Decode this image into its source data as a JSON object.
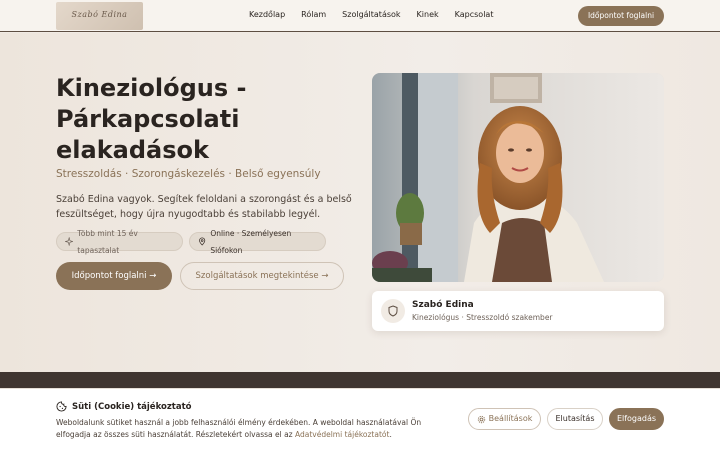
{
  "header": {
    "logo_text": "Szabó Edina",
    "nav": [
      "Kezdőlap",
      "Rólam",
      "Szolgáltatások",
      "Kinek",
      "Kapcsolat"
    ],
    "cta_label": "Időpontot foglalni"
  },
  "hero": {
    "title": "Kineziológus - Párkapcsolati elakadások",
    "subtitle": "Stresszoldás · Szorongáskezelés · Belső egyensúly",
    "intro": "Szabó Edina vagyok. Segítek feloldani a szorongást és a belső feszültséget, hogy újra nyugodtabb és stabilabb legyél.",
    "pills": [
      {
        "icon": "sparkle-icon",
        "label": "Több mint 15 év tapasztalat"
      },
      {
        "icon": "location-pin-icon",
        "label": "Online · Személyesen Siófokon"
      }
    ],
    "primary_cta": "Időpontot foglalni",
    "secondary_cta": "Szolgáltatások megtekintése"
  },
  "profile_card": {
    "icon": "shield-icon",
    "name": "Szabó Edina",
    "role": "Kineziológus · Stresszoldó szakember"
  },
  "cookie": {
    "icon": "cookie-icon",
    "title": "Süti (Cookie) tájékoztató",
    "text": "Weboldalunk sütiket használ a jobb felhasználói élmény érdekében. A weboldal használatával Ön elfogadja az összes süti használatát. Részletekért olvassa el az",
    "link": "Adatvédelmi tájékoztatót",
    "text_end": ".",
    "settings_label": "Beállítások",
    "reject_label": "Elutasítás",
    "accept_label": "Elfogadás"
  },
  "colors": {
    "accent": "#8a7257",
    "dark_band": "#3f3530",
    "background": "#f1ebe4"
  }
}
